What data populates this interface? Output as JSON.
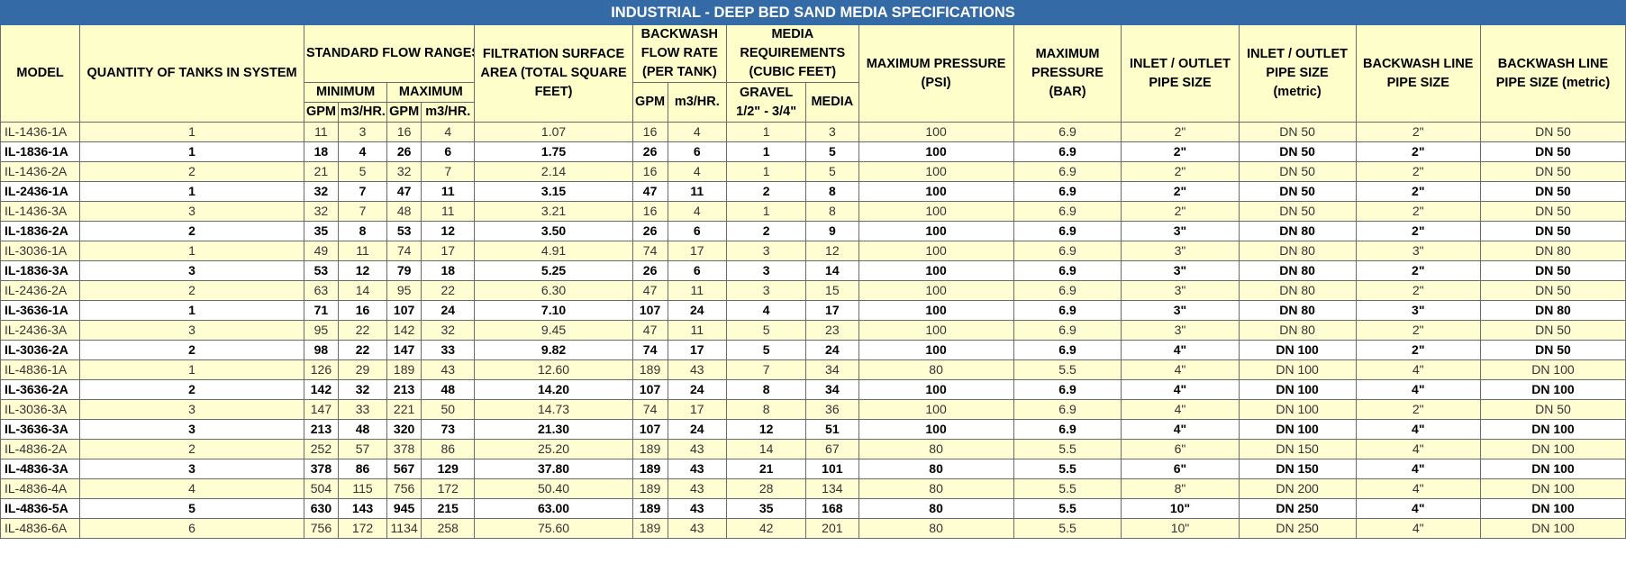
{
  "title": "INDUSTRIAL - DEEP BED SAND MEDIA SPECIFICATIONS",
  "headers": {
    "model": "MODEL",
    "quantity": "QUANTITY OF TANKS IN SYSTEM",
    "std_flow": "STANDARD FLOW RANGES",
    "minimum": "MINIMUM",
    "maximum": "MAXIMUM",
    "gpm": "GPM",
    "m3hr": "m3/HR.",
    "filtration": "FILTRATION SURFACE AREA (TOTAL SQUARE FEET)",
    "backwash": "BACKWASH FLOW RATE (PER TANK)",
    "media_req": "MEDIA REQUIREMENTS (CUBIC FEET)",
    "gravel": "GRAVEL 1/2\" - 3/4\"",
    "media": "MEDIA",
    "max_psi": "MAXIMUM PRESSURE (PSI)",
    "max_bar": "MAXIMUM PRESSURE (BAR)",
    "pipe": "INLET / OUTLET PIPE SIZE",
    "pipe_metric": "INLET / OUTLET PIPE SIZE (metric)",
    "bw_pipe": "BACKWASH LINE PIPE SIZE",
    "bw_pipe_metric": "BACKWASH LINE PIPE SIZE (metric)"
  },
  "rows": [
    [
      "IL-1436-1A",
      "1",
      "11",
      "3",
      "16",
      "4",
      "1.07",
      "16",
      "4",
      "1",
      "3",
      "100",
      "6.9",
      "2\"",
      "DN 50",
      "2\"",
      "DN 50"
    ],
    [
      "IL-1836-1A",
      "1",
      "18",
      "4",
      "26",
      "6",
      "1.75",
      "26",
      "6",
      "1",
      "5",
      "100",
      "6.9",
      "2\"",
      "DN 50",
      "2\"",
      "DN 50"
    ],
    [
      "IL-1436-2A",
      "2",
      "21",
      "5",
      "32",
      "7",
      "2.14",
      "16",
      "4",
      "1",
      "5",
      "100",
      "6.9",
      "2\"",
      "DN 50",
      "2\"",
      "DN 50"
    ],
    [
      "IL-2436-1A",
      "1",
      "32",
      "7",
      "47",
      "11",
      "3.15",
      "47",
      "11",
      "2",
      "8",
      "100",
      "6.9",
      "2\"",
      "DN 50",
      "2\"",
      "DN 50"
    ],
    [
      "IL-1436-3A",
      "3",
      "32",
      "7",
      "48",
      "11",
      "3.21",
      "16",
      "4",
      "1",
      "8",
      "100",
      "6.9",
      "2\"",
      "DN 50",
      "2\"",
      "DN 50"
    ],
    [
      "IL-1836-2A",
      "2",
      "35",
      "8",
      "53",
      "12",
      "3.50",
      "26",
      "6",
      "2",
      "9",
      "100",
      "6.9",
      "3\"",
      "DN 80",
      "2\"",
      "DN 50"
    ],
    [
      "IL-3036-1A",
      "1",
      "49",
      "11",
      "74",
      "17",
      "4.91",
      "74",
      "17",
      "3",
      "12",
      "100",
      "6.9",
      "3\"",
      "DN 80",
      "3\"",
      "DN 80"
    ],
    [
      "IL-1836-3A",
      "3",
      "53",
      "12",
      "79",
      "18",
      "5.25",
      "26",
      "6",
      "3",
      "14",
      "100",
      "6.9",
      "3\"",
      "DN 80",
      "2\"",
      "DN 50"
    ],
    [
      "IL-2436-2A",
      "2",
      "63",
      "14",
      "95",
      "22",
      "6.30",
      "47",
      "11",
      "3",
      "15",
      "100",
      "6.9",
      "3\"",
      "DN 80",
      "2\"",
      "DN 50"
    ],
    [
      "IL-3636-1A",
      "1",
      "71",
      "16",
      "107",
      "24",
      "7.10",
      "107",
      "24",
      "4",
      "17",
      "100",
      "6.9",
      "3\"",
      "DN 80",
      "3\"",
      "DN 80"
    ],
    [
      "IL-2436-3A",
      "3",
      "95",
      "22",
      "142",
      "32",
      "9.45",
      "47",
      "11",
      "5",
      "23",
      "100",
      "6.9",
      "3\"",
      "DN 80",
      "2\"",
      "DN 50"
    ],
    [
      "IL-3036-2A",
      "2",
      "98",
      "22",
      "147",
      "33",
      "9.82",
      "74",
      "17",
      "5",
      "24",
      "100",
      "6.9",
      "4\"",
      "DN 100",
      "2\"",
      "DN 50"
    ],
    [
      "IL-4836-1A",
      "1",
      "126",
      "29",
      "189",
      "43",
      "12.60",
      "189",
      "43",
      "7",
      "34",
      "80",
      "5.5",
      "4\"",
      "DN 100",
      "4\"",
      "DN 100"
    ],
    [
      "IL-3636-2A",
      "2",
      "142",
      "32",
      "213",
      "48",
      "14.20",
      "107",
      "24",
      "8",
      "34",
      "100",
      "6.9",
      "4\"",
      "DN 100",
      "4\"",
      "DN 100"
    ],
    [
      "IL-3036-3A",
      "3",
      "147",
      "33",
      "221",
      "50",
      "14.73",
      "74",
      "17",
      "8",
      "36",
      "100",
      "6.9",
      "4\"",
      "DN 100",
      "2\"",
      "DN 50"
    ],
    [
      "IL-3636-3A",
      "3",
      "213",
      "48",
      "320",
      "73",
      "21.30",
      "107",
      "24",
      "12",
      "51",
      "100",
      "6.9",
      "4\"",
      "DN 100",
      "4\"",
      "DN 100"
    ],
    [
      "IL-4836-2A",
      "2",
      "252",
      "57",
      "378",
      "86",
      "25.20",
      "189",
      "43",
      "14",
      "67",
      "80",
      "5.5",
      "6\"",
      "DN 150",
      "4\"",
      "DN 100"
    ],
    [
      "IL-4836-3A",
      "3",
      "378",
      "86",
      "567",
      "129",
      "37.80",
      "189",
      "43",
      "21",
      "101",
      "80",
      "5.5",
      "6\"",
      "DN 150",
      "4\"",
      "DN 100"
    ],
    [
      "IL-4836-4A",
      "4",
      "504",
      "115",
      "756",
      "172",
      "50.40",
      "189",
      "43",
      "28",
      "134",
      "80",
      "5.5",
      "8\"",
      "DN 200",
      "4\"",
      "DN 100"
    ],
    [
      "IL-4836-5A",
      "5",
      "630",
      "143",
      "945",
      "215",
      "63.00",
      "189",
      "43",
      "35",
      "168",
      "80",
      "5.5",
      "10\"",
      "DN 250",
      "4\"",
      "DN 100"
    ],
    [
      "IL-4836-6A",
      "6",
      "756",
      "172",
      "1134",
      "258",
      "75.60",
      "189",
      "43",
      "42",
      "201",
      "80",
      "5.5",
      "10\"",
      "DN 250",
      "4\"",
      "DN 100"
    ]
  ],
  "colors": {
    "title_bg": "#346aa5",
    "header_bg": "#fefeca",
    "light_row_bg": "#fefed2",
    "bold_row_bg": "#ffffff"
  }
}
